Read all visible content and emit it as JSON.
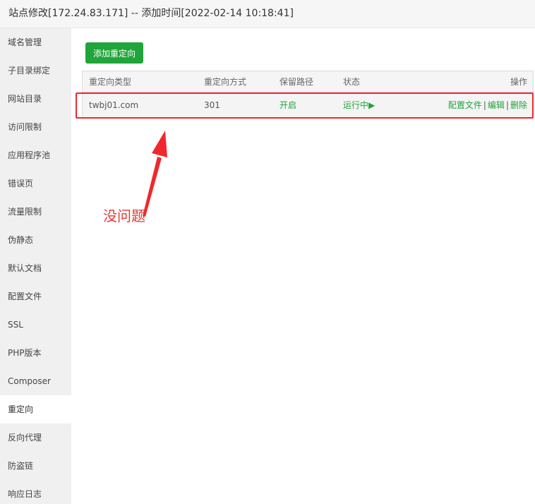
{
  "window": {
    "title": "站点修改[172.24.83.171] -- 添加时间[2022-02-14 10:18:41]"
  },
  "sidebar": {
    "items": [
      {
        "label": "域名管理"
      },
      {
        "label": "子目录绑定"
      },
      {
        "label": "网站目录"
      },
      {
        "label": "访问限制"
      },
      {
        "label": "应用程序池"
      },
      {
        "label": "错误页"
      },
      {
        "label": "流量限制"
      },
      {
        "label": "伪静态"
      },
      {
        "label": "默认文档"
      },
      {
        "label": "配置文件"
      },
      {
        "label": "SSL"
      },
      {
        "label": "PHP版本"
      },
      {
        "label": "Composer"
      },
      {
        "label": "重定向",
        "active": true
      },
      {
        "label": "反向代理"
      },
      {
        "label": "防盗链"
      },
      {
        "label": "响应日志"
      }
    ]
  },
  "toolbar": {
    "add_label": "添加重定向"
  },
  "table": {
    "headers": [
      "重定向类型",
      "重定向方式",
      "保留路径",
      "状态",
      "操作"
    ],
    "rows": [
      {
        "type": "twbj01.com",
        "method": "301",
        "keep_path": "开启",
        "status": "运行中▶",
        "actions": {
          "config": "配置文件",
          "edit": "编辑",
          "delete": "删除",
          "separator": "|"
        }
      }
    ]
  },
  "annotation": {
    "text": "没问题",
    "color": "#e53935"
  },
  "colors": {
    "accent": "#20a53a",
    "highlight": "#f0282d"
  }
}
